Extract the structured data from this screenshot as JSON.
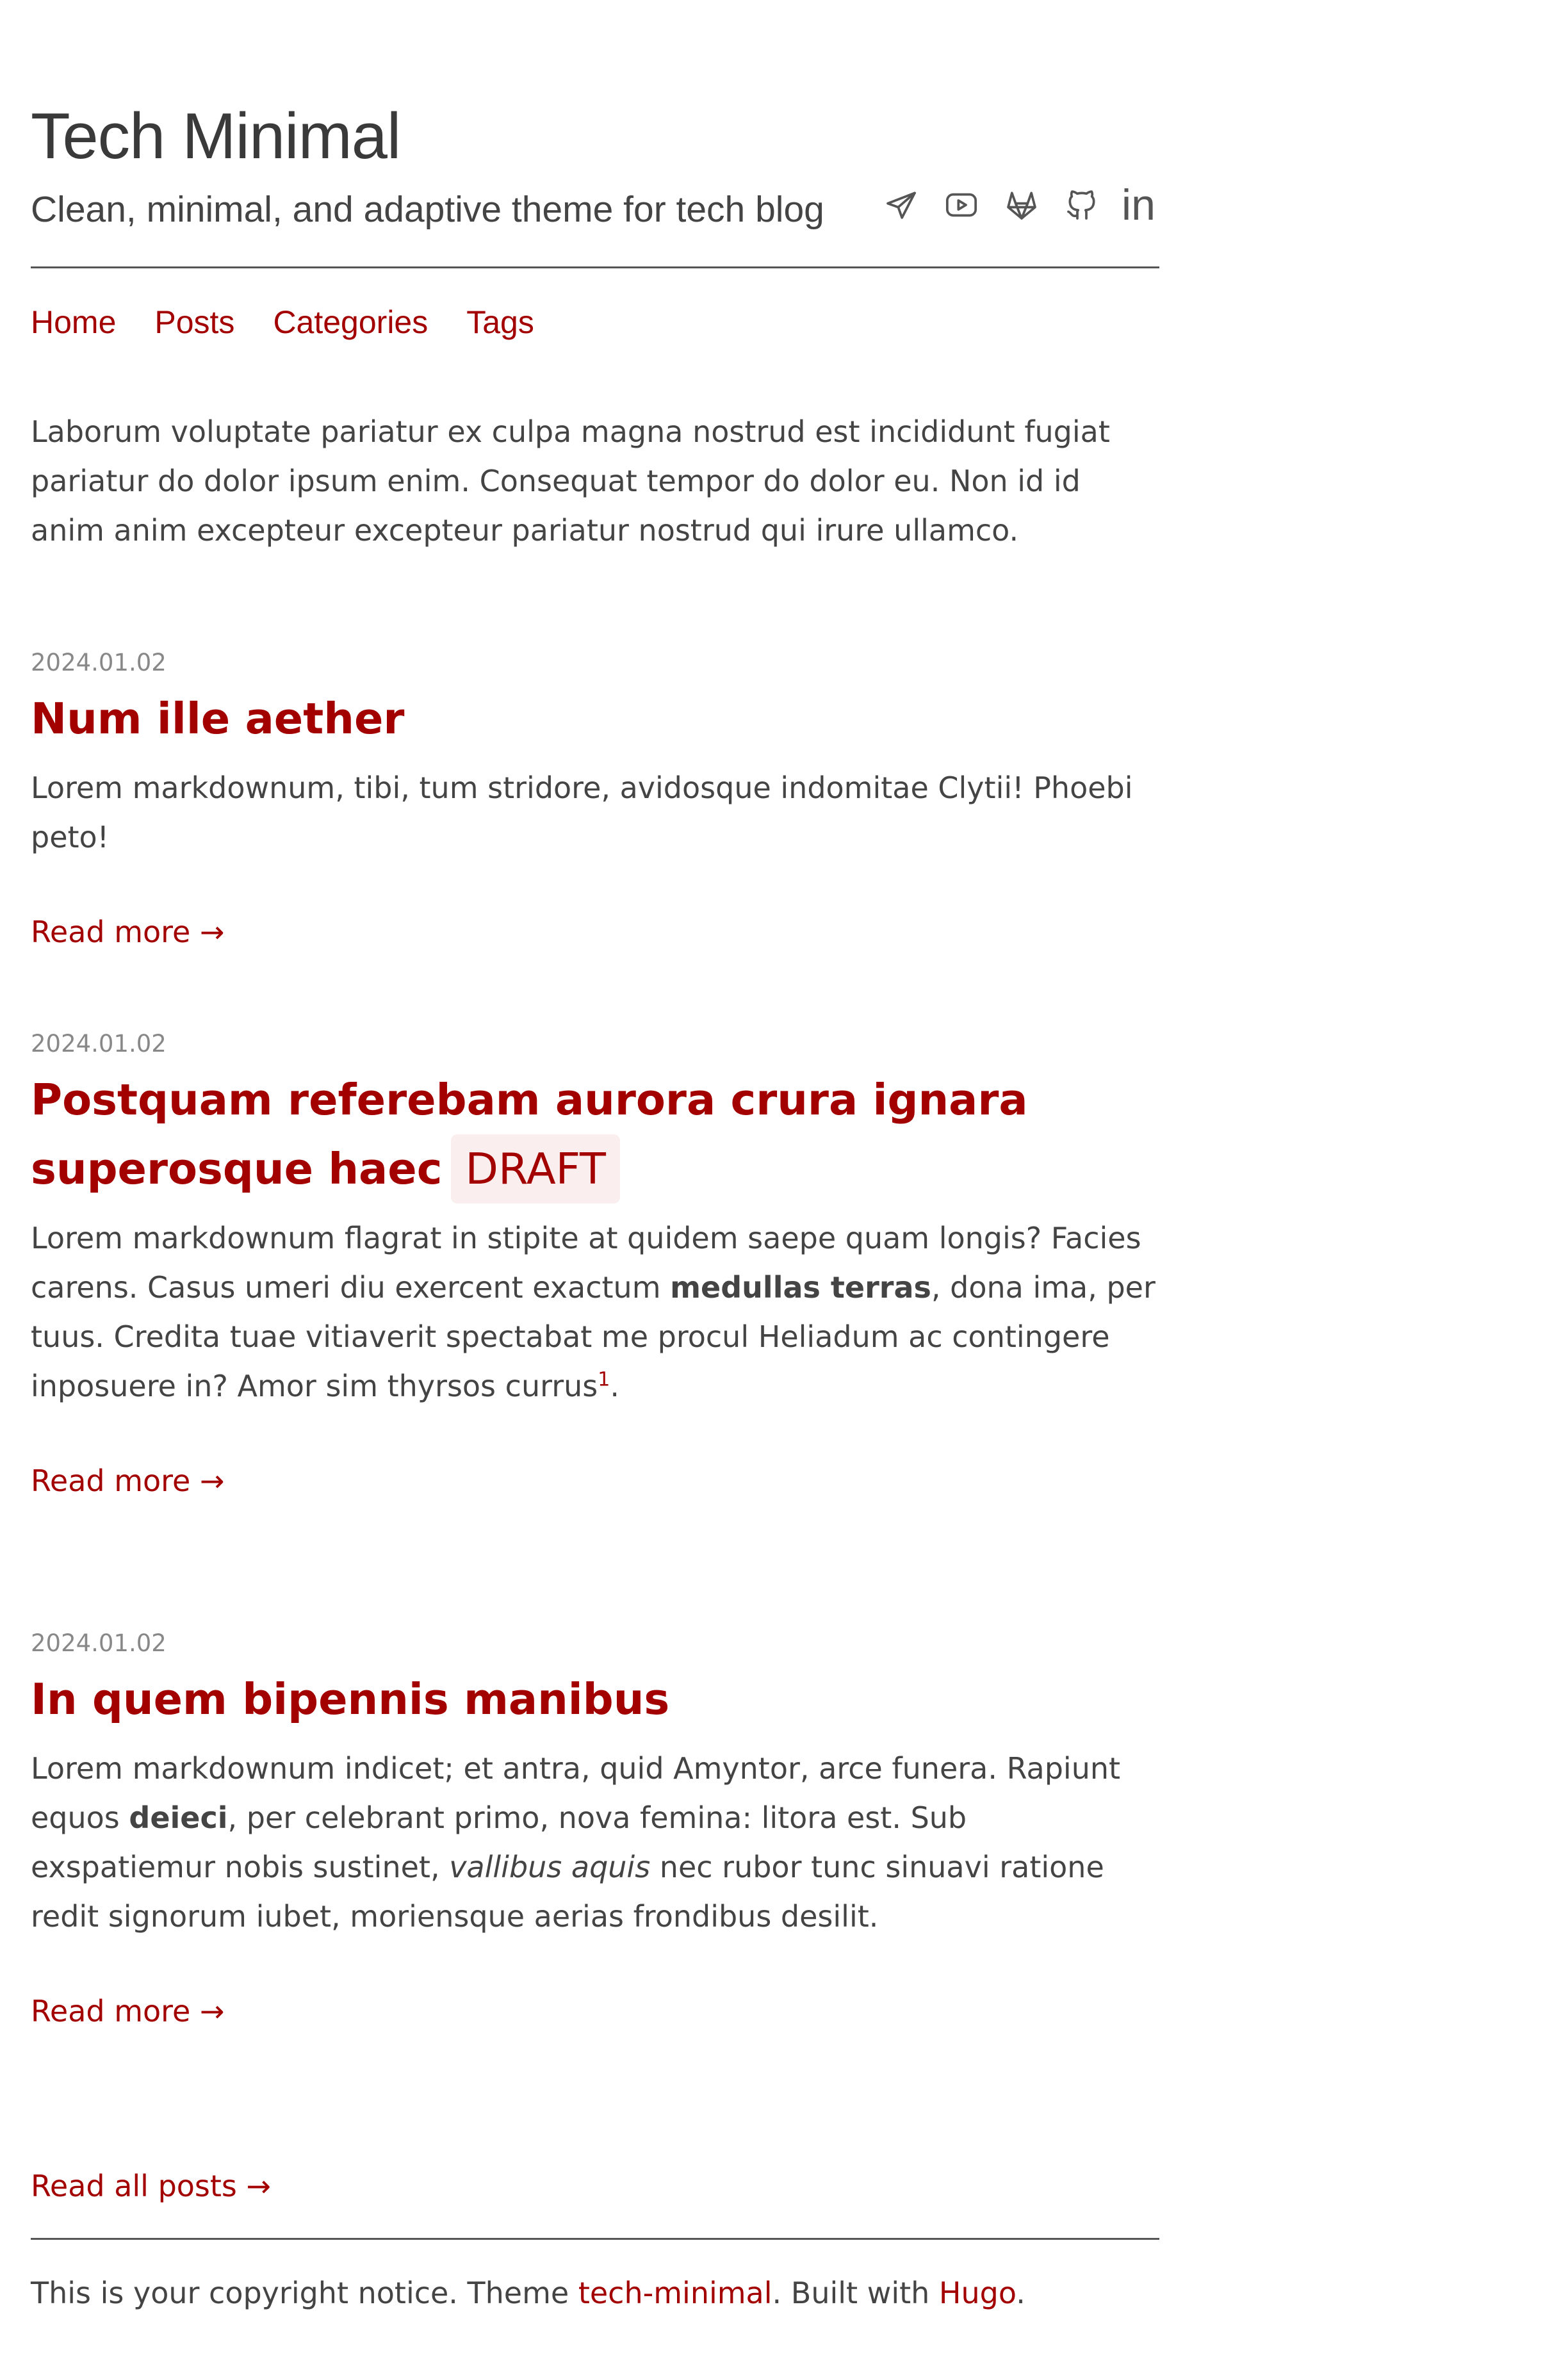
{
  "header": {
    "title": "Tech Minimal",
    "tagline": "Clean, minimal, and adaptive theme for tech blog",
    "social": [
      {
        "name": "telegram",
        "icon": "telegram-icon"
      },
      {
        "name": "youtube",
        "icon": "youtube-icon"
      },
      {
        "name": "gitlab",
        "icon": "gitlab-icon"
      },
      {
        "name": "github",
        "icon": "github-icon"
      },
      {
        "name": "linkedin",
        "icon": "linkedin-icon",
        "label": "in"
      }
    ]
  },
  "nav": {
    "home": "Home",
    "posts": "Posts",
    "categories": "Categories",
    "tags": "Tags"
  },
  "intro": "Laborum voluptate pariatur ex culpa magna nostrud est incididunt fugiat pariatur do dolor ipsum enim. Consequat tempor do dolor eu. Non id id anim anim excepteur excepteur pariatur nostrud qui irure ullamco.",
  "posts": [
    {
      "date": "2024.01.02",
      "title": "Num ille aether",
      "summary": "Lorem markdownum, tibi, tum stridore, avidosque indomitae Clytii! Phoebi peto!",
      "read_more": "Read more →"
    },
    {
      "date": "2024.01.02",
      "title": "Postquam referebam aurora crura ignara superosque haec",
      "badge": "DRAFT",
      "summary_parts": {
        "a": "Lorem markdownum flagrat in stipite at quidem saepe quam longis? Facies carens. Casus umeri diu exercent exactum ",
        "b_bold": "medullas terras",
        "c": ", dona ima, per tuus. Credita tuae vitiaverit spectabat me procul Heliadum ac contingere inposuere in? Amor sim thyrsos currus",
        "footnote": "1",
        "d": "."
      },
      "read_more": "Read more →"
    },
    {
      "date": "2024.01.02",
      "title": "In quem bipennis manibus",
      "summary_parts": {
        "a": "Lorem markdownum indicet; et antra, quid Amyntor, arce funera. Rapiunt equos ",
        "b_bold": "deieci",
        "c": ", per celebrant primo, nova femina: litora est. Sub exspatiemur nobis sustinet, ",
        "d_italic": "vallibus aquis",
        "e": " nec rubor tunc sinuavi ratione redit signorum iubet, moriensque aerias frondibus desilit."
      },
      "read_more": "Read more →"
    }
  ],
  "read_all": "Read all posts →",
  "footer": {
    "prefix": "This is your copyright notice. Theme ",
    "theme_link": "tech-minimal",
    "middle": ". Built with ",
    "hugo_link": "Hugo",
    "suffix": "."
  },
  "colors": {
    "accent": "#a30000",
    "text": "#444444",
    "muted": "#888888",
    "badge_bg": "#fbeeee"
  }
}
